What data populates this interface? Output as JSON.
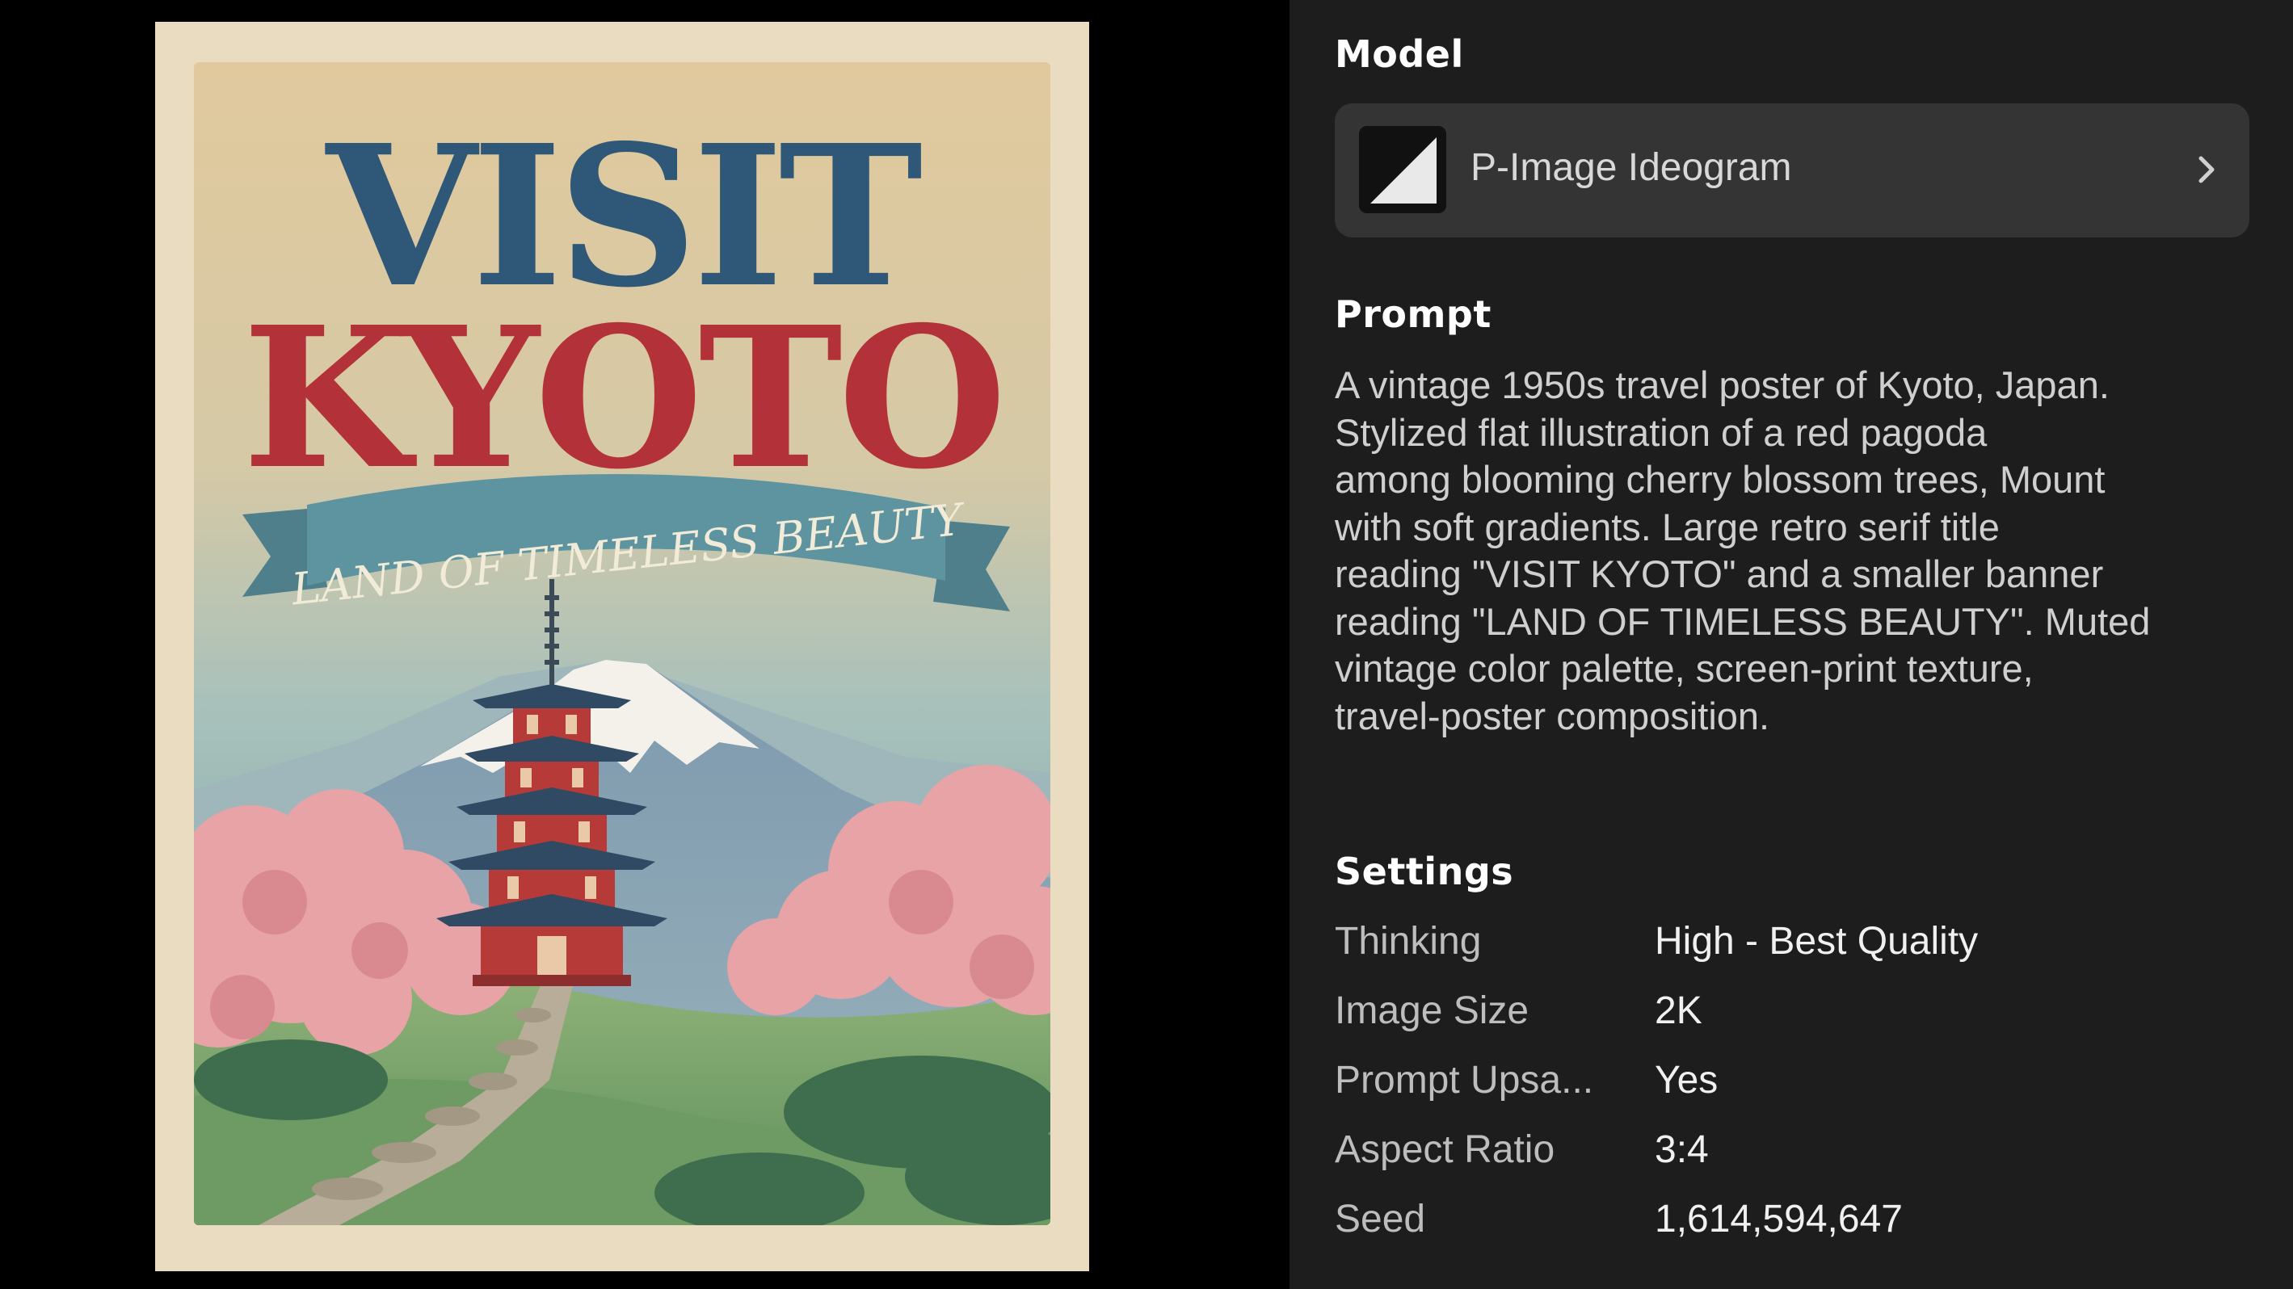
{
  "poster": {
    "title_line1": "VISIT",
    "title_line2": "KYOTO",
    "banner": "LAND OF TIMELESS BEAUTY"
  },
  "panel": {
    "model_section_title": "Model",
    "model_name": "P-Image Ideogram",
    "model_icon": "chevron-right-icon",
    "prompt_section_title": "Prompt",
    "prompt_text": "A vintage 1950s travel poster of Kyoto, Japan.\nStylized flat illustration of a red pagoda\namong blooming cherry blossom trees, Mount\nwith soft gradients. Large retro serif title\nreading \"VISIT KYOTO\" and a smaller banner\nreading \"LAND OF TIMELESS BEAUTY\". Muted\nvintage color palette, screen-print texture,\ntravel-poster composition.",
    "settings_section_title": "Settings",
    "settings": [
      {
        "label": "Thinking",
        "value": "High - Best Quality"
      },
      {
        "label": "Image Size",
        "value": "2K"
      },
      {
        "label": "Prompt Upsa...",
        "value": "Yes"
      },
      {
        "label": "Aspect Ratio",
        "value": "3:4"
      },
      {
        "label": "Seed",
        "value": "1,614,594,647"
      }
    ]
  },
  "colors": {
    "panel_bg": "#1d1d1d",
    "model_card_bg": "#343434",
    "title_blue": "#2f5878",
    "title_red": "#b3323a",
    "banner_teal": "#5e94a0"
  }
}
